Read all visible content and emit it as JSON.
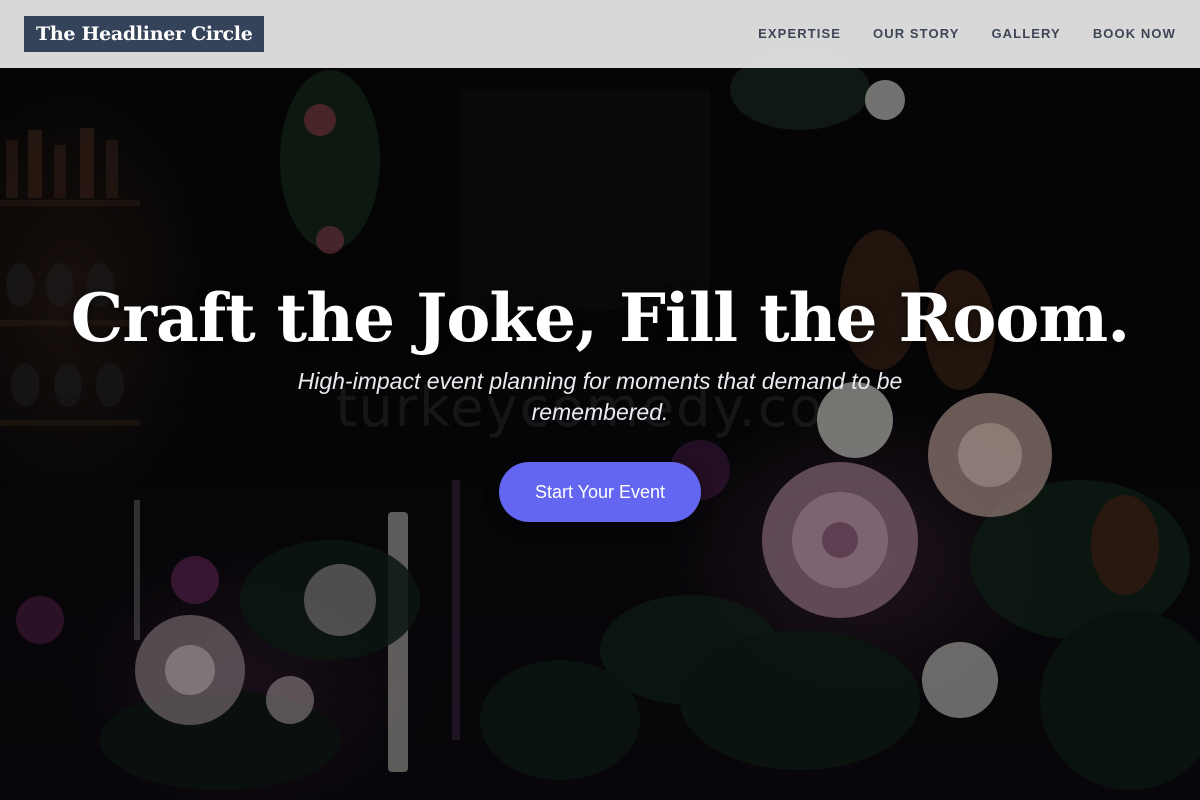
{
  "brand": {
    "name": "The Headliner Circle"
  },
  "nav": {
    "items": [
      {
        "label": "EXPERTISE"
      },
      {
        "label": "OUR STORY"
      },
      {
        "label": "GALLERY"
      },
      {
        "label": "BOOK NOW"
      }
    ]
  },
  "hero": {
    "headline": "Craft the Joke, Fill the Room.",
    "subtitle": "High-impact event planning for moments that demand to be remembered.",
    "cta_label": "Start Your Event",
    "watermark": "turkeycomedy.co",
    "background_image": "dark-floral-event-table"
  },
  "colors": {
    "navbar_bg": "#e8e8ea",
    "brand_bg": "#34425a",
    "nav_text": "#3e4656",
    "cta_bg": "#6366f1",
    "headline_text": "#ffffff"
  }
}
